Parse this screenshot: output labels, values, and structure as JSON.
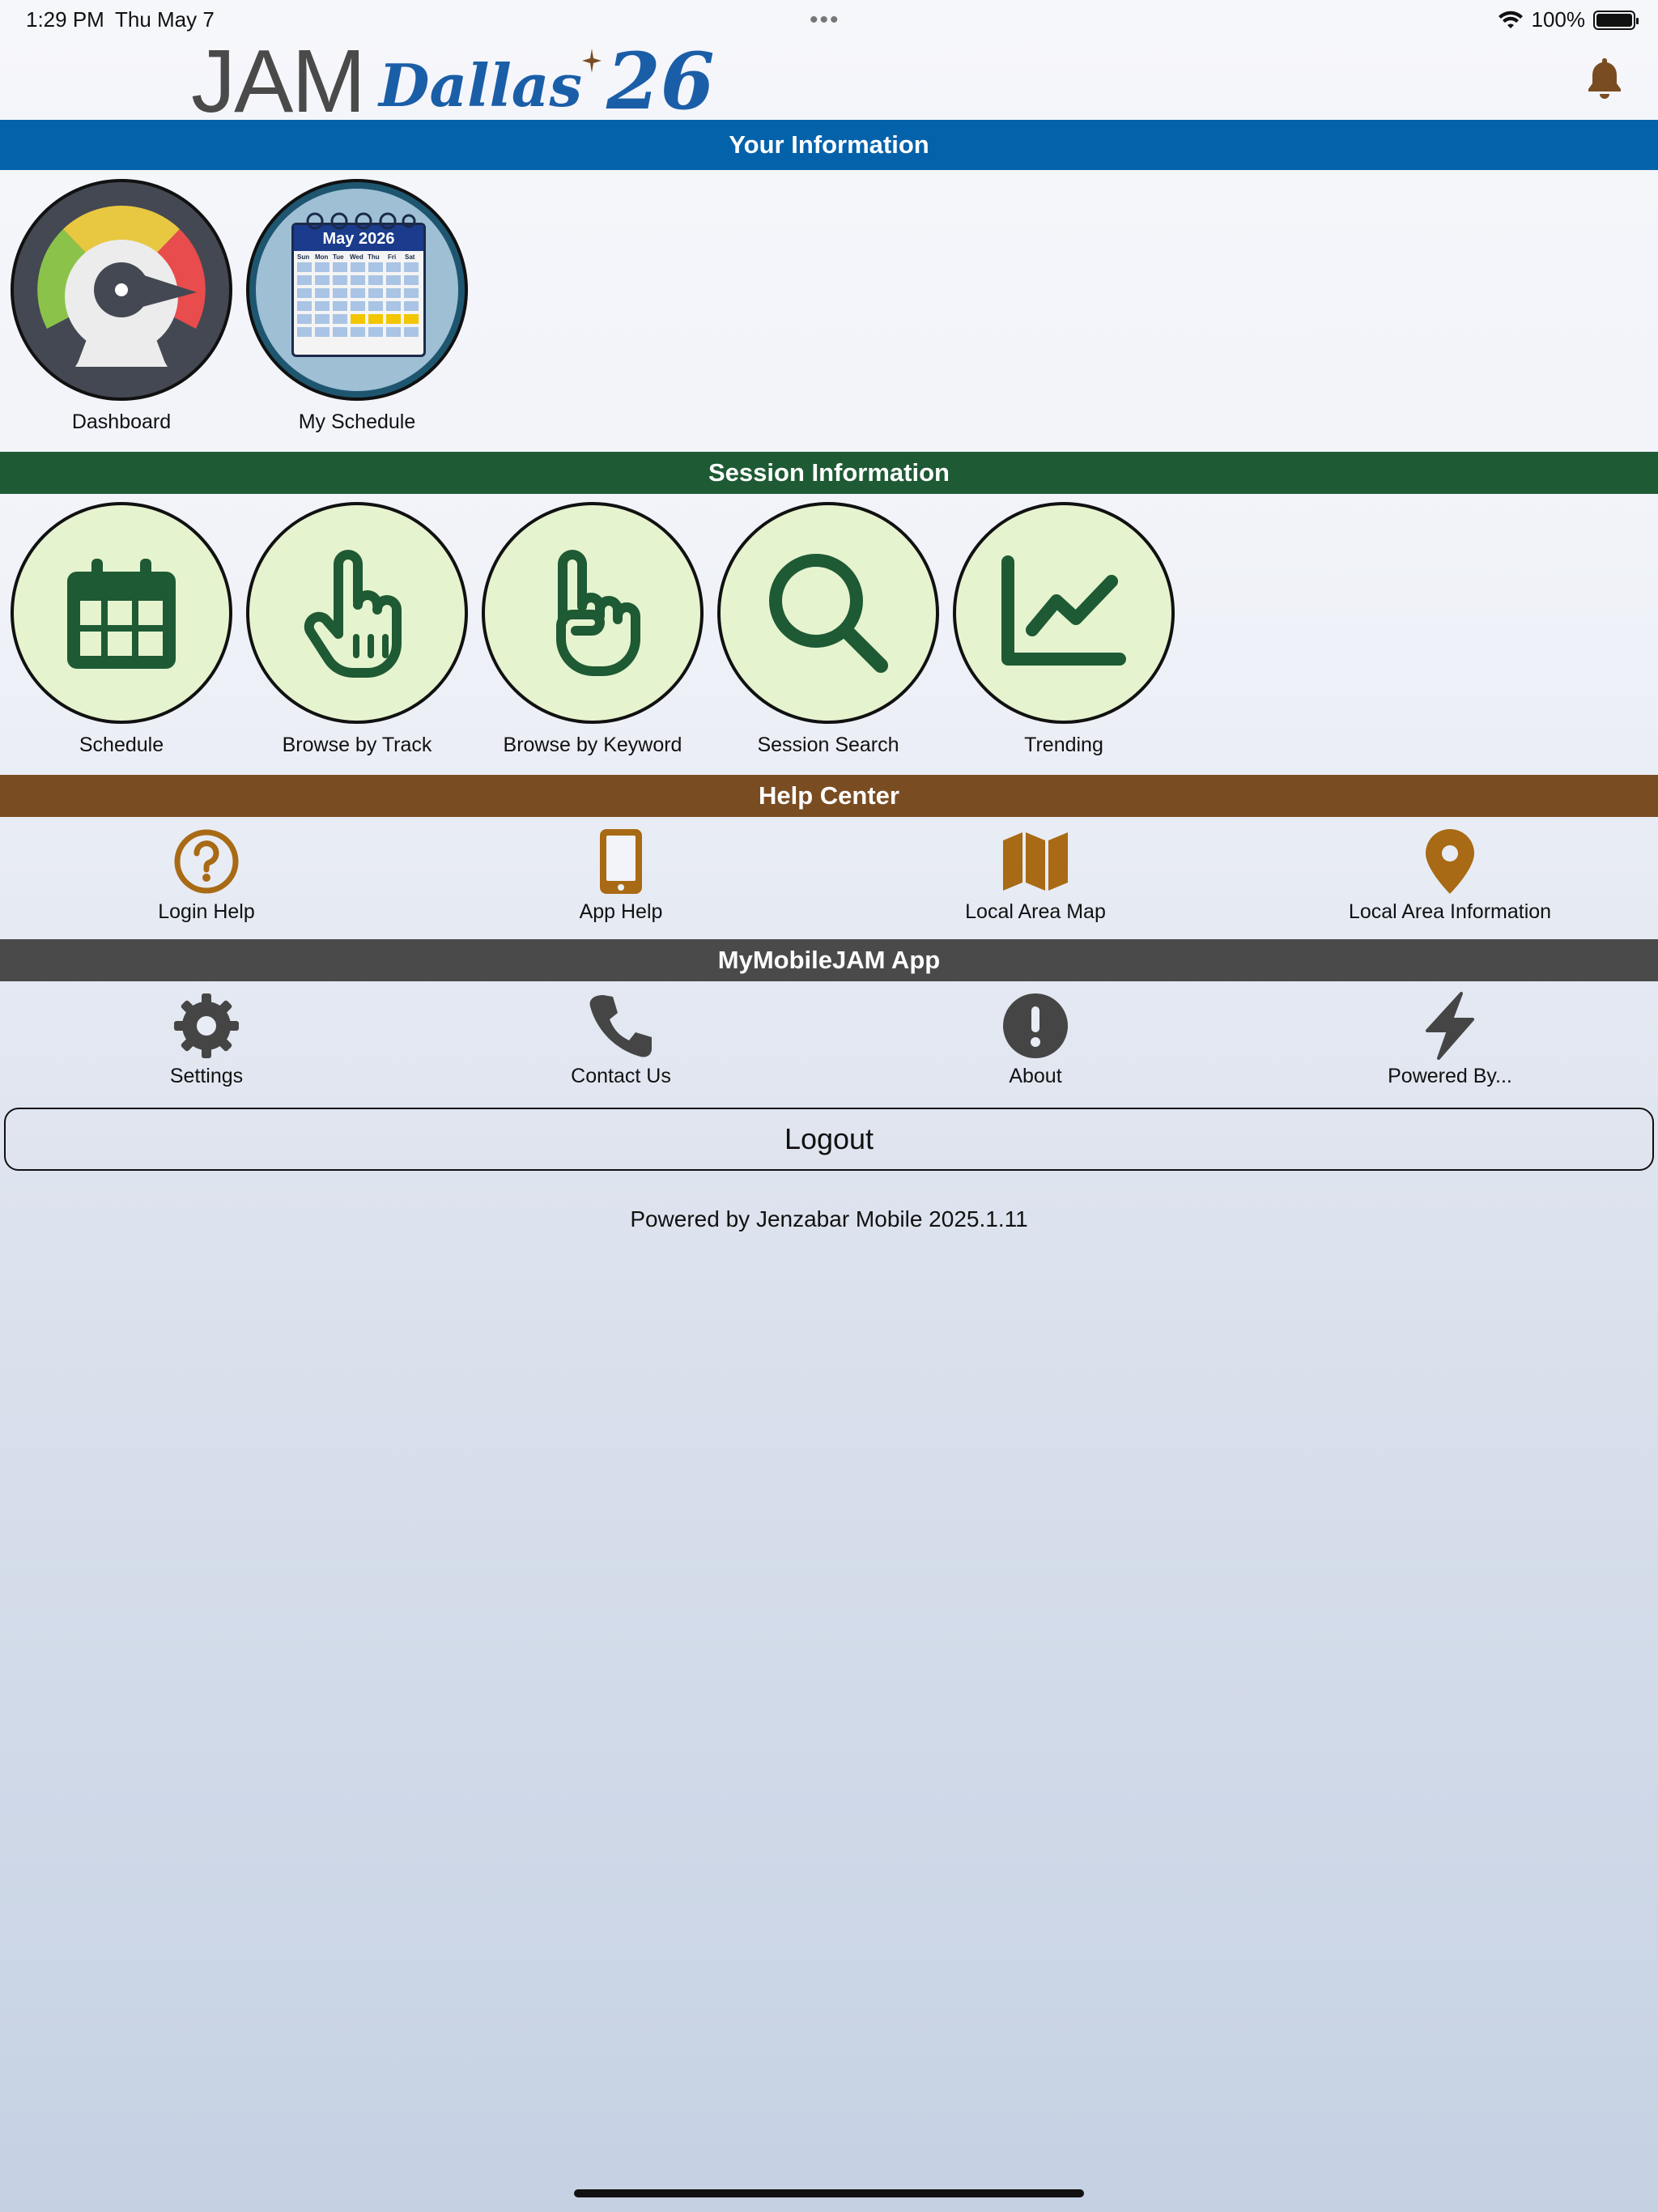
{
  "status_bar": {
    "time": "1:29 PM",
    "date": "Thu May 7",
    "battery": "100%"
  },
  "header": {
    "logo_jam": "JAM",
    "logo_dallas": "Dallas",
    "logo_year": "26"
  },
  "sections": {
    "your_information": "Your Information",
    "session_information": "Session Information",
    "help_center": "Help Center",
    "app": "MyMobileJAM App"
  },
  "your_information": {
    "dashboard": "Dashboard",
    "my_schedule": "My Schedule",
    "calendar_month": "May 2026",
    "calendar_days": [
      "Sun",
      "Mon",
      "Tue",
      "Wed",
      "Thu",
      "Fri",
      "Sat"
    ]
  },
  "session_information": {
    "schedule": "Schedule",
    "browse_track": "Browse by Track",
    "browse_keyword": "Browse by Keyword",
    "session_search": "Session Search",
    "trending": "Trending"
  },
  "help_center": {
    "login_help": "Login Help",
    "app_help": "App Help",
    "local_map": "Local Area Map",
    "local_info": "Local Area Information"
  },
  "app": {
    "settings": "Settings",
    "contact": "Contact Us",
    "about": "About",
    "powered_by": "Powered By..."
  },
  "logout_label": "Logout",
  "footer_text": "Powered by Jenzabar Mobile 2025.1.11",
  "colors": {
    "blue_bar": "#0462ab",
    "green_bar": "#1e5a34",
    "brown_bar": "#7a4c22",
    "gray_bar": "#4a4a4a",
    "session_icon": "#1e5a34",
    "help_icon": "#a86a14",
    "app_icon": "#454545",
    "bell": "#7a4c22"
  },
  "icons": {
    "bell": "bell-icon",
    "dashboard": "gauge-icon",
    "my_schedule": "calendar-icon",
    "schedule": "calendar-grid-icon",
    "browse_track": "pointing-hand-icon",
    "browse_keyword": "raised-finger-icon",
    "session_search": "search-icon",
    "trending": "line-chart-icon",
    "login_help": "question-circle-icon",
    "app_help": "mobile-phone-icon",
    "local_map": "map-icon",
    "local_info": "map-pin-icon",
    "settings": "gear-icon",
    "contact": "phone-icon",
    "about": "exclamation-circle-icon",
    "powered_by": "bolt-icon"
  }
}
